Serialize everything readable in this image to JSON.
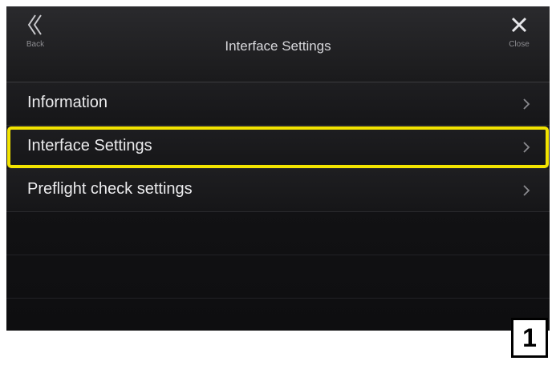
{
  "header": {
    "title": "Interface Settings",
    "back_label": "Back",
    "close_label": "Close"
  },
  "menu": {
    "items": [
      {
        "label": "Information"
      },
      {
        "label": "Interface Settings",
        "selected": true
      },
      {
        "label": "Preflight check settings"
      }
    ]
  },
  "callout": {
    "number": "1"
  },
  "colors": {
    "highlight": "#f2e300",
    "background": "#121214",
    "text": "#ececee"
  }
}
